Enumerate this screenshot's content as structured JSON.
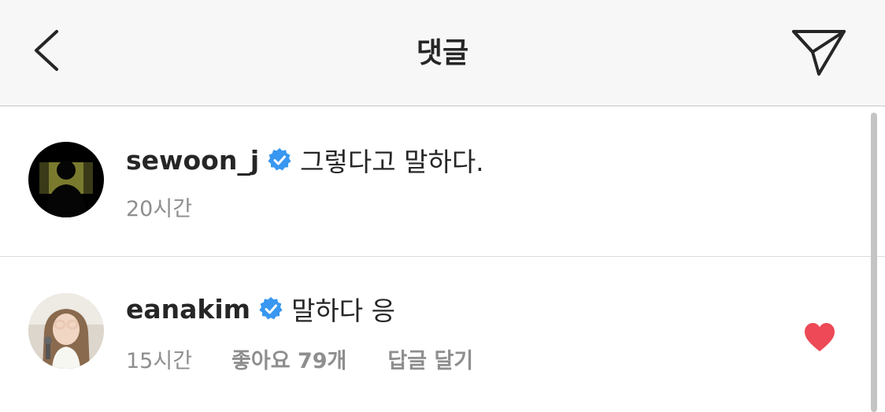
{
  "header": {
    "title": "댓글",
    "back_icon": "chevron-left-icon",
    "share_icon": "paper-plane-icon"
  },
  "comments": [
    {
      "username": "sewoon_j",
      "verified": true,
      "text": "그렇다고 말하다.",
      "time": "20시간"
    },
    {
      "username": "eanakim",
      "verified": true,
      "text": "말하다 응",
      "time": "15시간",
      "likes": "좋아요 79개",
      "reply": "답글 달기",
      "liked": true
    }
  ],
  "colors": {
    "verified_blue": "#3897f0",
    "heart_red": "#ed4956",
    "meta_gray": "#8e8e8e",
    "header_bg": "#f7f7f7"
  }
}
